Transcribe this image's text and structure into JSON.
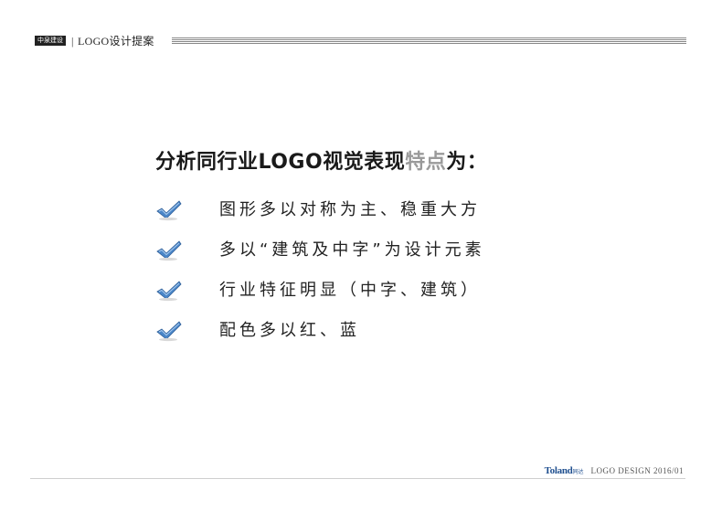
{
  "header": {
    "brand": "中泉建设",
    "separator": "|",
    "title": "LOGO设计提案"
  },
  "headline": {
    "prefix": "分析同行业LOGO视觉表现",
    "highlight": "特点",
    "suffix": "为："
  },
  "items": [
    {
      "icon": "check-icon",
      "text": "图形多以对称为主、稳重大方"
    },
    {
      "icon": "check-icon",
      "text": "多以“建筑及中字”为设计元素"
    },
    {
      "icon": "check-icon",
      "text": "行业特征明显（中字、建筑）"
    },
    {
      "icon": "check-icon",
      "text": "配色多以红、蓝"
    }
  ],
  "footer": {
    "logo": "Toland",
    "logo_sub": "同达",
    "text": "LOGO DESIGN 2016/01"
  },
  "colors": {
    "highlight": "#9a9a9a",
    "check_blue": "#4a86c8",
    "footer_logo": "#1f4f8f"
  }
}
